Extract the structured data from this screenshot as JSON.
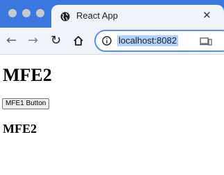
{
  "browser": {
    "tab": {
      "title": "React App",
      "favicon": "globe-icon"
    },
    "address_bar": {
      "url": "localhost:8082"
    },
    "colors": {
      "titlebar": "#3a78e0",
      "toolbar": "#f0f3fa",
      "url_highlight": "#b3d1fd"
    }
  },
  "page": {
    "heading": "MFE2",
    "button_label": "MFE1 Button",
    "subheading": "MFE2"
  }
}
